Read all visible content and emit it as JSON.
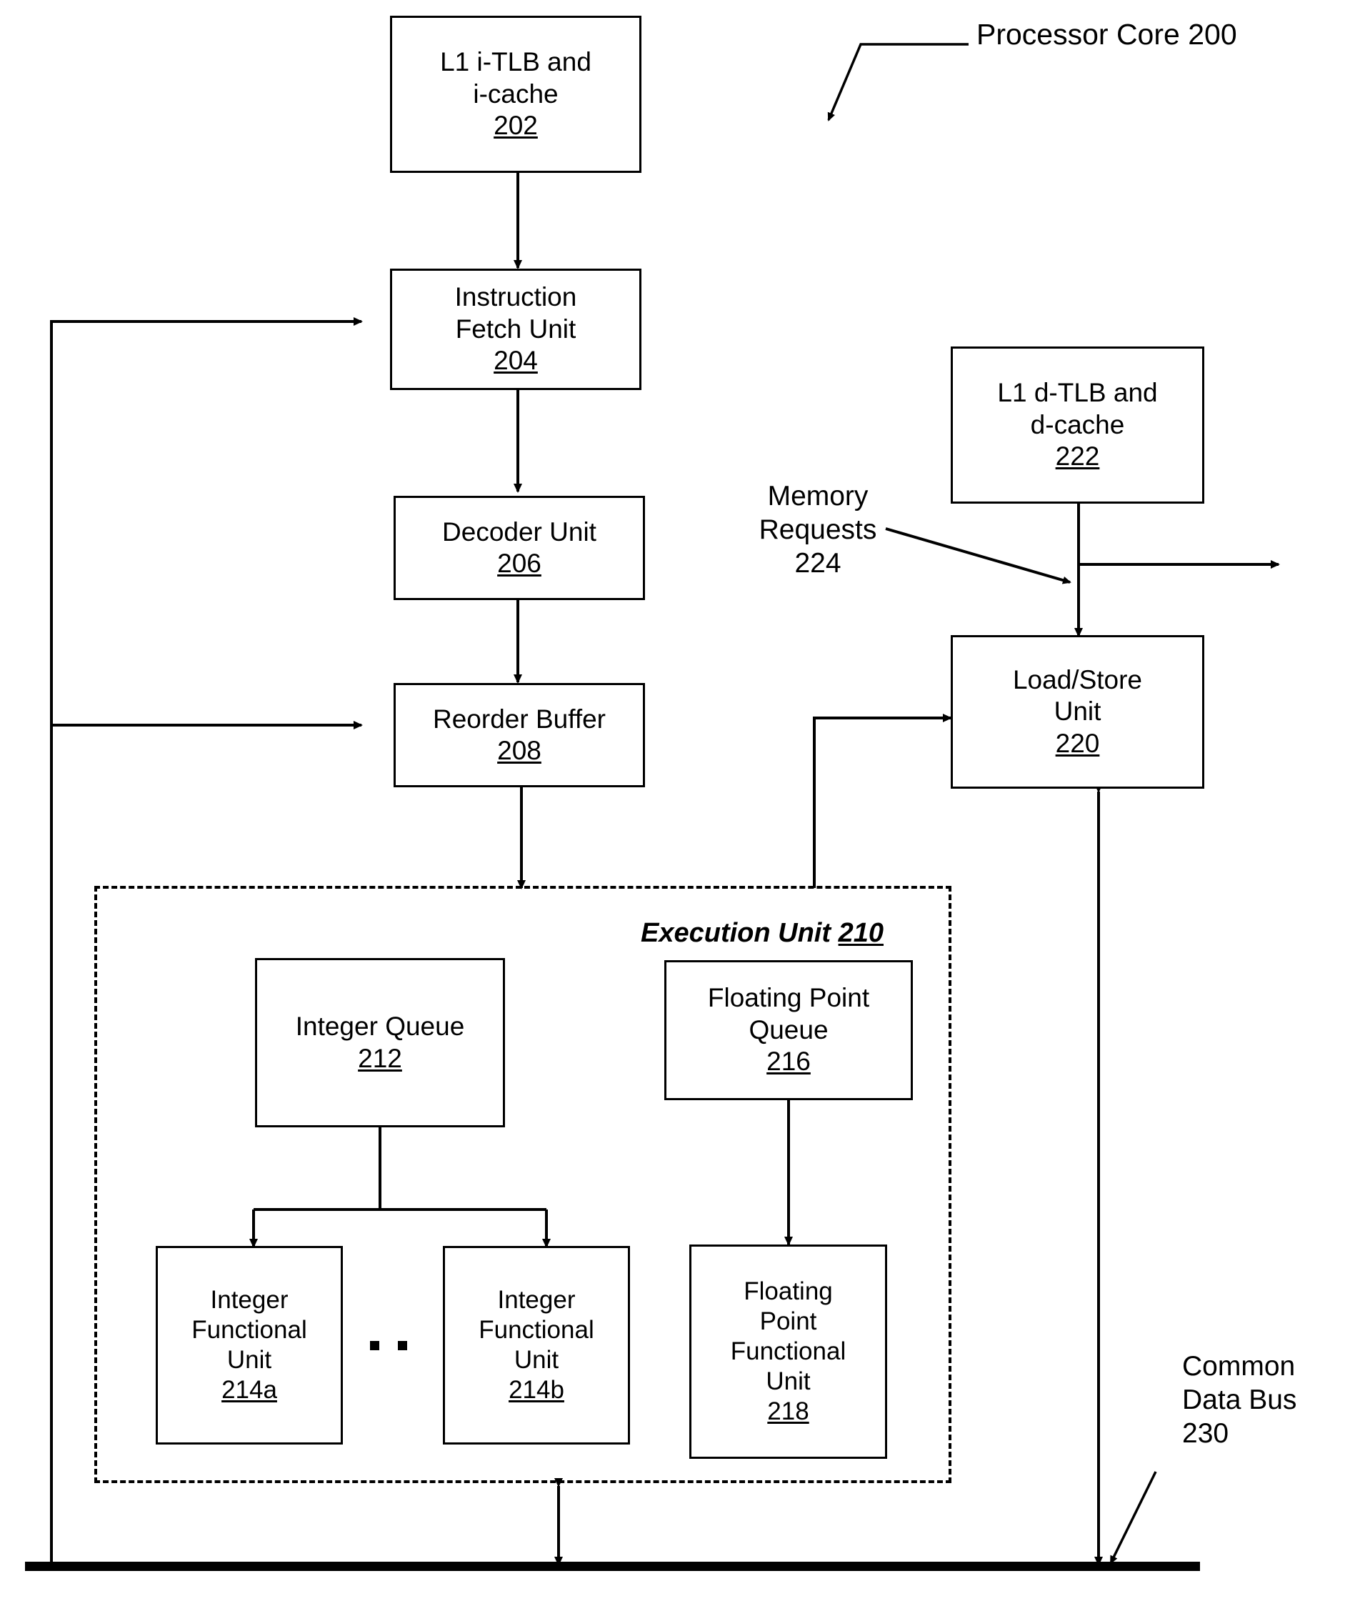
{
  "figure": {
    "title_label": "Processor Core 200",
    "title_ref": "200"
  },
  "boxes": {
    "l1_itlb": {
      "line1": "L1 i-TLB and",
      "line2": "i-cache",
      "ref": "202"
    },
    "ifu": {
      "line1": "Instruction",
      "line2": "Fetch Unit",
      "ref": "204"
    },
    "decoder": {
      "line1": "Decoder Unit",
      "ref": "206"
    },
    "rob": {
      "line1": "Reorder Buffer",
      "ref": "208"
    },
    "l1_dtlb": {
      "line1": "L1 d-TLB and",
      "line2": "d-cache",
      "ref": "222"
    },
    "lsu": {
      "line1": "Load/Store",
      "line2": "Unit",
      "ref": "220"
    },
    "int_queue": {
      "line1": "Integer Queue",
      "ref": "212"
    },
    "fp_queue": {
      "line1": "Floating Point",
      "line2": "Queue",
      "ref": "216"
    },
    "ifu_a": {
      "line1": "Integer",
      "line2": "Functional",
      "line3": "Unit",
      "ref": "214a"
    },
    "ifu_b": {
      "line1": "Integer",
      "line2": "Functional",
      "line3": "Unit",
      "ref": "214b"
    },
    "fpfu": {
      "line1": "Floating",
      "line2": "Point",
      "line3": "Functional",
      "line4": "Unit",
      "ref": "218"
    }
  },
  "execution_unit": {
    "label": "Execution Unit",
    "ref": "210"
  },
  "labels": {
    "memory_requests": "Memory\nRequests\n224",
    "memory_requests_text": "Memory Requests",
    "memory_requests_ref": "224",
    "common_data_bus": "Common\nData Bus\n230",
    "common_data_bus_text": "Common Data Bus",
    "common_data_bus_ref": "230"
  },
  "colors": {
    "stroke": "#000000",
    "background": "#ffffff"
  }
}
